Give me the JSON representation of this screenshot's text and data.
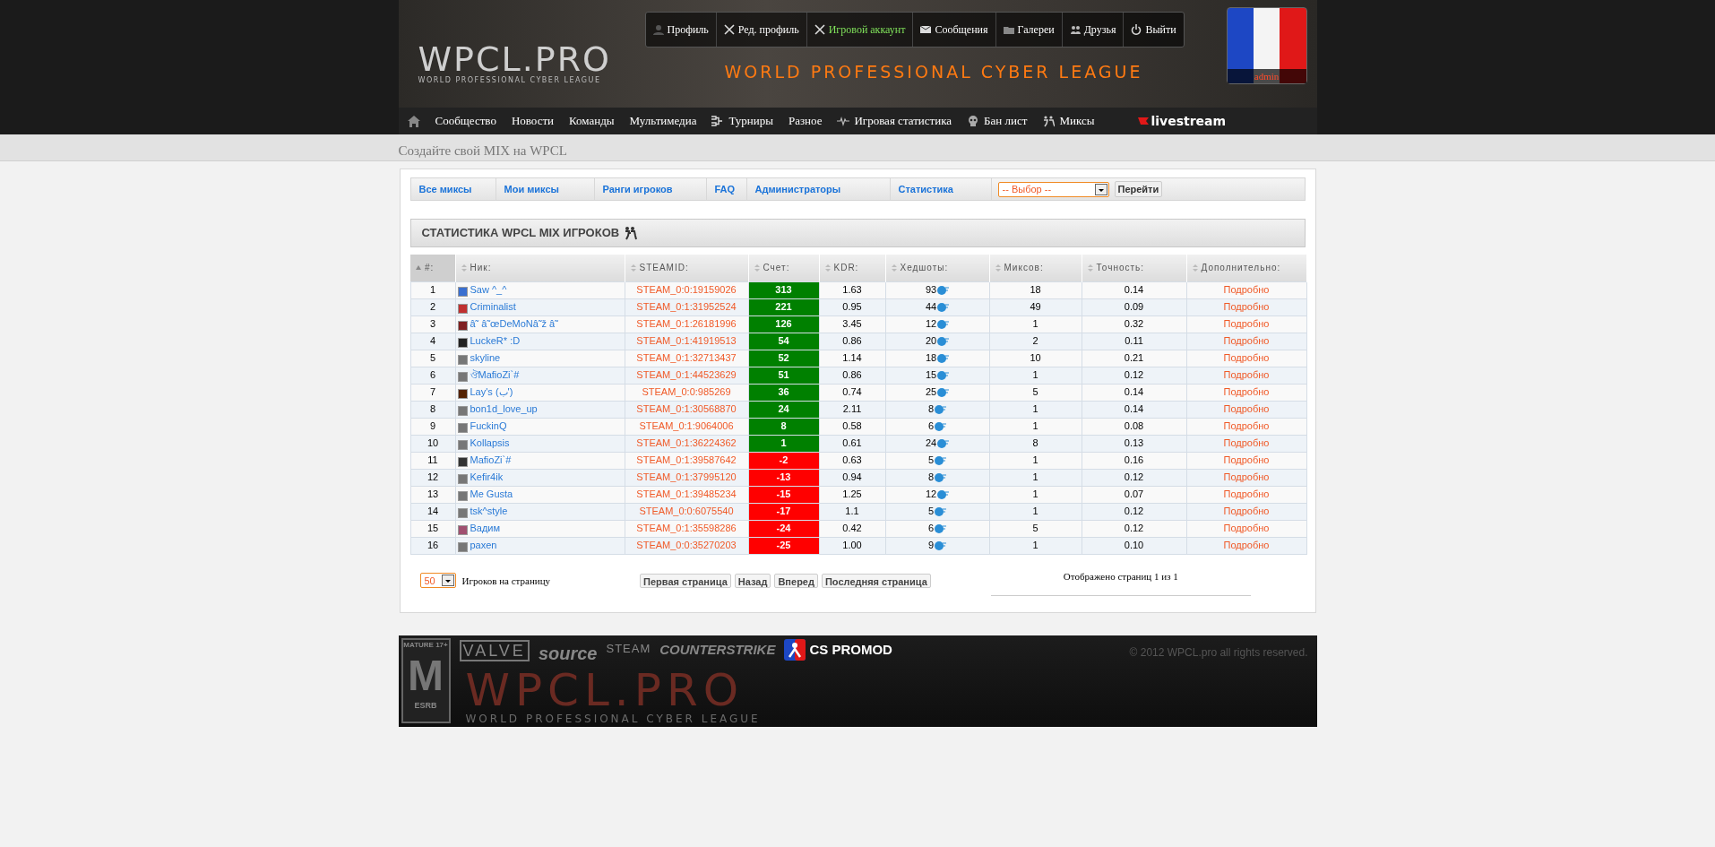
{
  "header": {
    "logo": "WPCL.PRO",
    "logo_subtitle": "WORLD PROFESSIONAL CYBER LEAGUE",
    "banner_text": "WORLD PROFESSIONAL CYBER LEAGUE",
    "user_menu": [
      {
        "label": "Профиль",
        "kind": "user",
        "selected": false
      },
      {
        "label": "Ред. профиль",
        "kind": "tools",
        "selected": false
      },
      {
        "label": "Игровой аккаунт",
        "kind": "tools",
        "selected": true
      },
      {
        "label": "Сообщения",
        "kind": "mail",
        "selected": false
      },
      {
        "label": "Галереи",
        "kind": "folder",
        "selected": false
      },
      {
        "label": "Друзья",
        "kind": "users",
        "selected": false
      },
      {
        "label": "Выйти",
        "kind": "power",
        "selected": false
      }
    ],
    "avatar_label": "admin"
  },
  "nav": [
    {
      "label": "Сообщество",
      "kind": "plain"
    },
    {
      "label": "Новости",
      "kind": "plain"
    },
    {
      "label": "Команды",
      "kind": "plain"
    },
    {
      "label": "Мультимедиа",
      "kind": "plain"
    },
    {
      "label": "Турниры",
      "kind": "bracket"
    },
    {
      "label": "Разное",
      "kind": "plain"
    },
    {
      "label": "Игровая статистика",
      "kind": "pulse"
    },
    {
      "label": "Бан лист",
      "kind": "skull"
    },
    {
      "label": "Миксы",
      "kind": "fighters"
    }
  ],
  "nav_stream": "livestream",
  "page_title": "Создайте свой MIX на WPCL",
  "tabs": [
    "Все миксы",
    "Мои миксы",
    "Ранги игроков",
    "FAQ",
    "Администраторы",
    "Статистика"
  ],
  "select": {
    "value": "-- Выбор --"
  },
  "go_button": "Перейти",
  "section_title": "СТАТИСТИКА WPCL MIX ИГРОКОВ",
  "table": {
    "columns": [
      {
        "label": "#:",
        "sorted": true
      },
      {
        "label": "Ник:",
        "sorted": false
      },
      {
        "label": "STEAMID:",
        "sorted": false
      },
      {
        "label": "Счет:",
        "sorted": false
      },
      {
        "label": "KDR:",
        "sorted": false
      },
      {
        "label": "Хедшоты:",
        "sorted": false
      },
      {
        "label": "Миксов:",
        "sorted": false
      },
      {
        "label": "Точность:",
        "sorted": false
      },
      {
        "label": "Дополнительно:",
        "sorted": false
      }
    ],
    "rows": [
      {
        "rank": "1",
        "nick": "Saw ^_^",
        "steamid": "STEAM_0:0:19159026",
        "score": {
          "text": "313",
          "color": "#008000"
        },
        "kdr": "1.63",
        "headshots": "93",
        "mixes": "18",
        "accuracy": "0.14",
        "more": "Подробно"
      },
      {
        "rank": "2",
        "nick": "Criminalist",
        "steamid": "STEAM_0:1:31952524",
        "score": {
          "text": "221",
          "color": "#008000"
        },
        "kdr": "0.95",
        "headshots": "44",
        "mixes": "49",
        "accuracy": "0.09",
        "more": "Подробно"
      },
      {
        "rank": "3",
        "nick": "â˜ â˜œDeMoNâ˜ž â˜",
        "steamid": "STEAM_0:1:26181996",
        "score": {
          "text": "126",
          "color": "#008000"
        },
        "kdr": "3.45",
        "headshots": "12",
        "mixes": "1",
        "accuracy": "0.32",
        "more": "Подробно"
      },
      {
        "rank": "4",
        "nick": "LuckeR* :D",
        "steamid": "STEAM_0:1:41919513",
        "score": {
          "text": "54",
          "color": "#008000"
        },
        "kdr": "0.86",
        "headshots": "20",
        "mixes": "2",
        "accuracy": "0.11",
        "more": "Подробно"
      },
      {
        "rank": "5",
        "nick": "skyline",
        "steamid": "STEAM_0:1:32713437",
        "score": {
          "text": "52",
          "color": "#008000"
        },
        "kdr": "1.14",
        "headshots": "18",
        "mixes": "10",
        "accuracy": "0.21",
        "more": "Подробно"
      },
      {
        "rank": "6",
        "nick": "ঔMafioZi`#",
        "steamid": "STEAM_0:1:44523629",
        "score": {
          "text": "51",
          "color": "#008000"
        },
        "kdr": "0.86",
        "headshots": "15",
        "mixes": "1",
        "accuracy": "0.12",
        "more": "Подробно"
      },
      {
        "rank": "7",
        "nick": "Lay's (ب')",
        "steamid": "STEAM_0:0:985269",
        "score": {
          "text": "36",
          "color": "#008000"
        },
        "kdr": "0.74",
        "headshots": "25",
        "mixes": "5",
        "accuracy": "0.14",
        "more": "Подробно"
      },
      {
        "rank": "8",
        "nick": "bon1d_love_up",
        "steamid": "STEAM_0:1:30568870",
        "score": {
          "text": "24",
          "color": "#008000"
        },
        "kdr": "2.11",
        "headshots": "8",
        "mixes": "1",
        "accuracy": "0.14",
        "more": "Подробно"
      },
      {
        "rank": "9",
        "nick": "FuckinQ",
        "steamid": "STEAM_0:1:9064006",
        "score": {
          "text": "8",
          "color": "#008000"
        },
        "kdr": "0.58",
        "headshots": "6",
        "mixes": "1",
        "accuracy": "0.08",
        "more": "Подробно"
      },
      {
        "rank": "10",
        "nick": "Kollapsis",
        "steamid": "STEAM_0:1:36224362",
        "score": {
          "text": "1",
          "color": "#008000"
        },
        "kdr": "0.61",
        "headshots": "24",
        "mixes": "8",
        "accuracy": "0.13",
        "more": "Подробно"
      },
      {
        "rank": "11",
        "nick": "MafioZi`#",
        "steamid": "STEAM_0:1:39587642",
        "score": {
          "text": "-2",
          "color": "#ff0000"
        },
        "kdr": "0.63",
        "headshots": "5",
        "mixes": "1",
        "accuracy": "0.16",
        "more": "Подробно"
      },
      {
        "rank": "12",
        "nick": "Kefir4ik",
        "steamid": "STEAM_0:1:37995120",
        "score": {
          "text": "-13",
          "color": "#ff0000"
        },
        "kdr": "0.94",
        "headshots": "8",
        "mixes": "1",
        "accuracy": "0.12",
        "more": "Подробно"
      },
      {
        "rank": "13",
        "nick": "Me Gusta",
        "steamid": "STEAM_0:1:39485234",
        "score": {
          "text": "-15",
          "color": "#ff0000"
        },
        "kdr": "1.25",
        "headshots": "12",
        "mixes": "1",
        "accuracy": "0.07",
        "more": "Подробно"
      },
      {
        "rank": "14",
        "nick": "tsk^style",
        "steamid": "STEAM_0:0:6075540",
        "score": {
          "text": "-17",
          "color": "#ff0000"
        },
        "kdr": "1.1",
        "headshots": "5",
        "mixes": "1",
        "accuracy": "0.12",
        "more": "Подробно"
      },
      {
        "rank": "15",
        "nick": "Вадим",
        "steamid": "STEAM_0:1:35598286",
        "score": {
          "text": "-24",
          "color": "#ff0000"
        },
        "kdr": "0.42",
        "headshots": "6",
        "mixes": "5",
        "accuracy": "0.12",
        "more": "Подробно"
      },
      {
        "rank": "16",
        "nick": "paxen",
        "steamid": "STEAM_0:0:35270203",
        "score": {
          "text": "-25",
          "color": "#ff0000"
        },
        "kdr": "1.00",
        "headshots": "9",
        "mixes": "1",
        "accuracy": "0.10",
        "more": "Подробно"
      }
    ]
  },
  "pagination": {
    "per_page": "50",
    "per_page_label": "Игроков на страницу",
    "buttons": [
      "Первая страница",
      "Назад",
      "Вперед",
      "Последняя страница"
    ],
    "summary": "Отображено страниц 1 из 1"
  },
  "footer": {
    "rating": "MATURE 17+",
    "rating_letter": "M",
    "rating_org": "ESRB",
    "logos": [
      "VALVE",
      "source",
      "STEAM",
      "COUNTERSTRIKE"
    ],
    "promod": "CS PROMOD",
    "copyright": "© 2012 WPCL.pro all rights reserved.",
    "logo": "WPCL.PRO",
    "logo_subtitle": "WORLD PROFESSIONAL CYBER LEAGUE"
  }
}
